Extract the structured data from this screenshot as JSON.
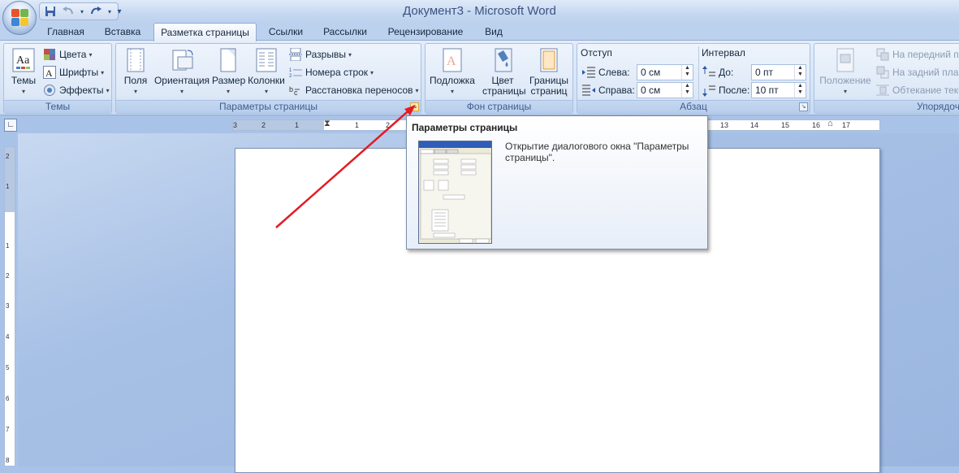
{
  "window": {
    "title": "Документ3 - Microsoft Word"
  },
  "qat": {
    "icons": [
      "save-icon",
      "undo-icon",
      "redo-icon",
      "customize-icon"
    ]
  },
  "tabs": [
    "Главная",
    "Вставка",
    "Разметка страницы",
    "Ссылки",
    "Рассылки",
    "Рецензирование",
    "Вид"
  ],
  "active_tab": "Разметка страницы",
  "ribbon": {
    "themes": {
      "label": "Темы",
      "btn": "Темы",
      "colors": "Цвета",
      "fonts": "Шрифты",
      "effects": "Эффекты"
    },
    "page_setup": {
      "label": "Параметры страницы",
      "margins": "Поля",
      "orientation": "Ориентация",
      "size": "Размер",
      "columns": "Колонки",
      "breaks": "Разрывы",
      "line_numbers": "Номера строк",
      "hyphenation": "Расстановка переносов"
    },
    "page_bg": {
      "label": "Фон страницы",
      "watermark": "Подложка",
      "page_color_1": "Цвет",
      "page_color_2": "страницы",
      "borders_1": "Границы",
      "borders_2": "страниц"
    },
    "paragraph": {
      "label": "Абзац",
      "indent_title": "Отступ",
      "left_label": "Слева:",
      "left_value": "0 см",
      "right_label": "Справа:",
      "right_value": "0 см",
      "spacing_title": "Интервал",
      "before_label": "До:",
      "before_value": "0 пт",
      "after_label": "После:",
      "after_value": "10 пт"
    },
    "arrange": {
      "label": "Упорядочить",
      "position": "Положение",
      "front": "На передний план",
      "back": "На задний план",
      "wrap": "Обтекание текстом"
    }
  },
  "tooltip": {
    "title": "Параметры страницы",
    "description": "Открытие диалогового окна \"Параметры страницы\"."
  },
  "rulers": {
    "h_ticks": [
      "3",
      "2",
      "1",
      "1",
      "2",
      "3",
      "13",
      "14",
      "15",
      "16",
      "17"
    ],
    "v_ticks": [
      "2",
      "1",
      "1",
      "2",
      "3",
      "4",
      "5",
      "6",
      "7",
      "8"
    ]
  },
  "colors": {
    "accent": "#e31b23",
    "ribbon_bg": "#dbe7f7",
    "workspace": "#a9c3e8"
  }
}
